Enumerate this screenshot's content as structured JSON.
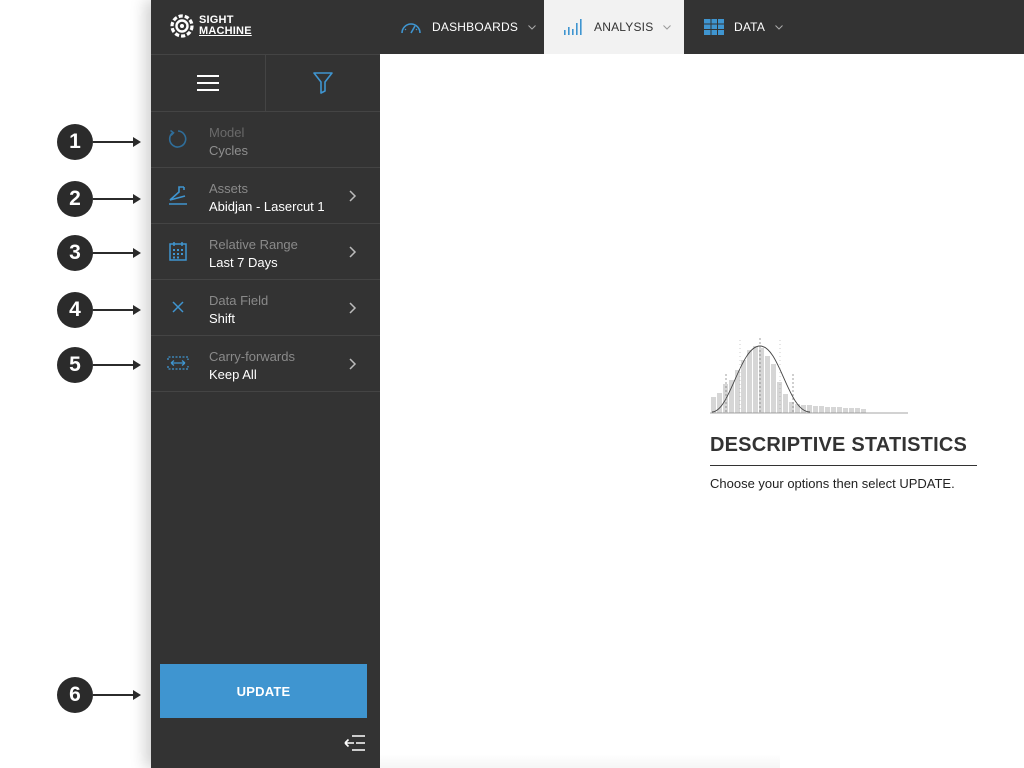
{
  "app": {
    "logo_line1": "SIGHT",
    "logo_line2": "MACHINE"
  },
  "topnav": {
    "items": [
      {
        "label": "DASHBOARDS",
        "icon": "gauge-icon",
        "active": false
      },
      {
        "label": "ANALYSIS",
        "icon": "bar-chart-icon",
        "active": true
      },
      {
        "label": "DATA",
        "icon": "table-icon",
        "active": false
      }
    ]
  },
  "toolbar": {
    "menu_icon": "hamburger-icon",
    "filter_icon": "filter-icon"
  },
  "sidebar": {
    "items": [
      {
        "label": "Model",
        "value": "Cycles",
        "icon": "refresh-icon",
        "disabled": true
      },
      {
        "label": "Assets",
        "value": "Abidjan - Lasercut 1",
        "icon": "machine-arm-icon"
      },
      {
        "label": "Relative Range",
        "value": "Last 7 Days",
        "icon": "calendar-icon"
      },
      {
        "label": "Data Field",
        "value": "Shift",
        "icon": "x-axis-icon"
      },
      {
        "label": "Carry-forwards",
        "value": "Keep All",
        "icon": "carry-forward-icon"
      }
    ],
    "update_label": "UPDATE",
    "collapse_icon": "collapse-sidebar-icon"
  },
  "callouts": [
    "1",
    "2",
    "3",
    "4",
    "5",
    "6"
  ],
  "main": {
    "title": "DESCRIPTIVE STATISTICS",
    "subtitle": "Choose your options then select UPDATE.",
    "illustration": "histogram-bell-curve-icon"
  },
  "colors": {
    "sidebar_bg": "#333333",
    "accent_blue": "#3f95d0",
    "active_tab_bg": "#f2f2f2"
  }
}
